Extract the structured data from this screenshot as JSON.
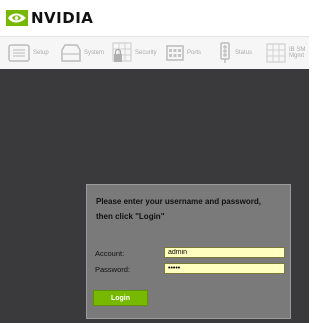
{
  "brand": {
    "name": "NVIDIA",
    "logo_icon": "nvidia-eye-icon",
    "color": "#76b900"
  },
  "toolbar": {
    "items": [
      {
        "label": "Setup",
        "icon": "setup-icon"
      },
      {
        "label": "System",
        "icon": "system-icon"
      },
      {
        "label": "Security",
        "icon": "security-icon"
      },
      {
        "label": "Ports",
        "icon": "ports-icon"
      },
      {
        "label": "Status",
        "icon": "status-icon"
      },
      {
        "label": "IB SM",
        "label2": "Mgmt",
        "icon": "ib-sm-mgmt-icon"
      }
    ]
  },
  "login": {
    "prompt_line1": "Please enter your username and password,",
    "prompt_line2": "then click \"Login\"",
    "account_label": "Account:",
    "account_value": "admin",
    "password_label": "Password:",
    "password_value": "admin",
    "button_label": "Login"
  },
  "colors": {
    "accent": "#76b900",
    "field_background": "#ffffc0",
    "main_background": "#3a3a3c",
    "panel_background": "#7a7a7a"
  }
}
